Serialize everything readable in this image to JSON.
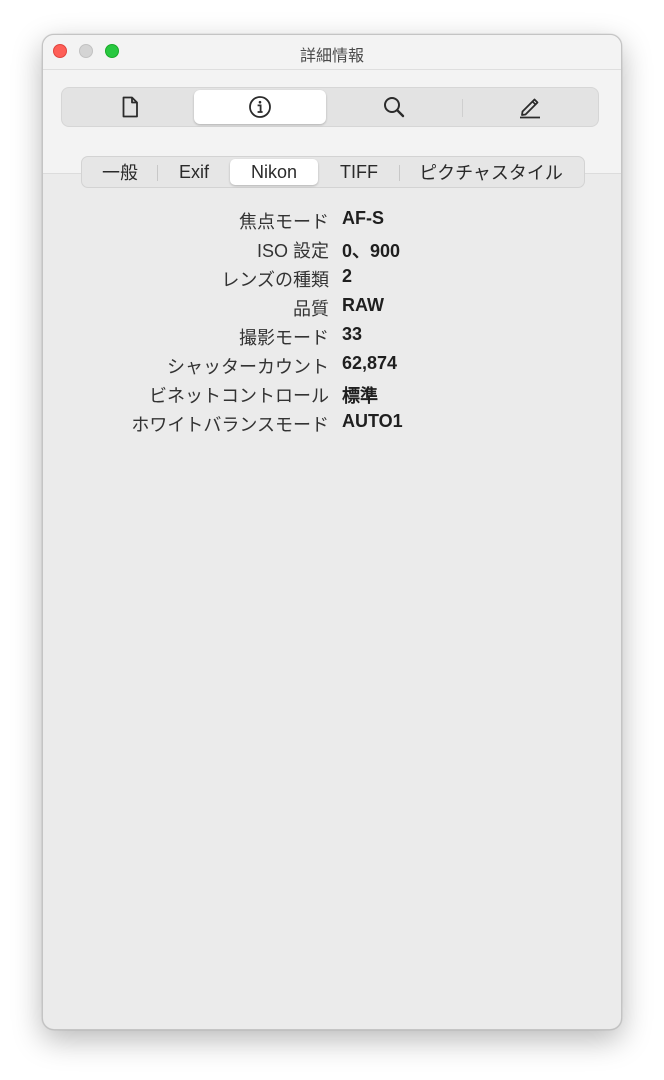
{
  "window": {
    "title": "詳細情報"
  },
  "toolbar": {
    "buttons": [
      {
        "icon": "document-icon",
        "selected": false
      },
      {
        "icon": "info-icon",
        "selected": true
      },
      {
        "icon": "search-icon",
        "selected": false
      },
      {
        "icon": "edit-icon",
        "selected": false
      }
    ]
  },
  "tabs": [
    {
      "label": "一般",
      "selected": false
    },
    {
      "label": "Exif",
      "selected": false
    },
    {
      "label": "Nikon",
      "selected": true
    },
    {
      "label": "TIFF",
      "selected": false
    },
    {
      "label": "ピクチャスタイル",
      "selected": false
    }
  ],
  "info": [
    {
      "label": "焦点モード",
      "value": "AF-S"
    },
    {
      "label": "ISO 設定",
      "value": "0、900"
    },
    {
      "label": "レンズの種類",
      "value": "2"
    },
    {
      "label": "品質",
      "value": "RAW"
    },
    {
      "label": "撮影モード",
      "value": "33"
    },
    {
      "label": "シャッターカウント",
      "value": "62,874"
    },
    {
      "label": "ビネットコントロール",
      "value": "標準"
    },
    {
      "label": "ホワイトバランスモード",
      "value": "AUTO1"
    }
  ],
  "colors": {
    "close": "#fe5f57",
    "minimize_inactive": "#d4d4d4",
    "zoom": "#28c840",
    "window_bg": "#ebebeb"
  }
}
